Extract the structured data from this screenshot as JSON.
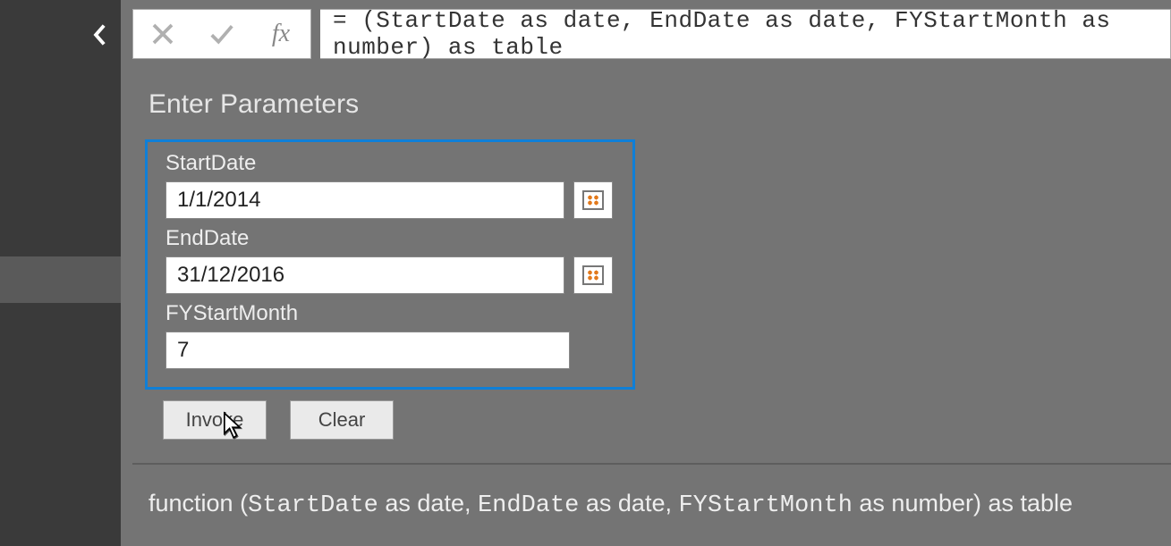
{
  "formula_bar": {
    "expression": "= (StartDate as date, EndDate as date, FYStartMonth as number) as table"
  },
  "heading": "Enter Parameters",
  "params": {
    "start_date": {
      "label": "StartDate",
      "value": "1/1/2014"
    },
    "end_date": {
      "label": "EndDate",
      "value": "31/12/2016"
    },
    "fy_start_month": {
      "label": "FYStartMonth",
      "value": "7"
    }
  },
  "buttons": {
    "invoke": "Invoke",
    "clear": "Clear"
  },
  "signature": {
    "prefix": "function (",
    "p1": "StartDate",
    "p1t": " as date, ",
    "p2": "EndDate",
    "p2t": " as date, ",
    "p3": "FYStartMonth",
    "p3t": " as number) as table"
  }
}
